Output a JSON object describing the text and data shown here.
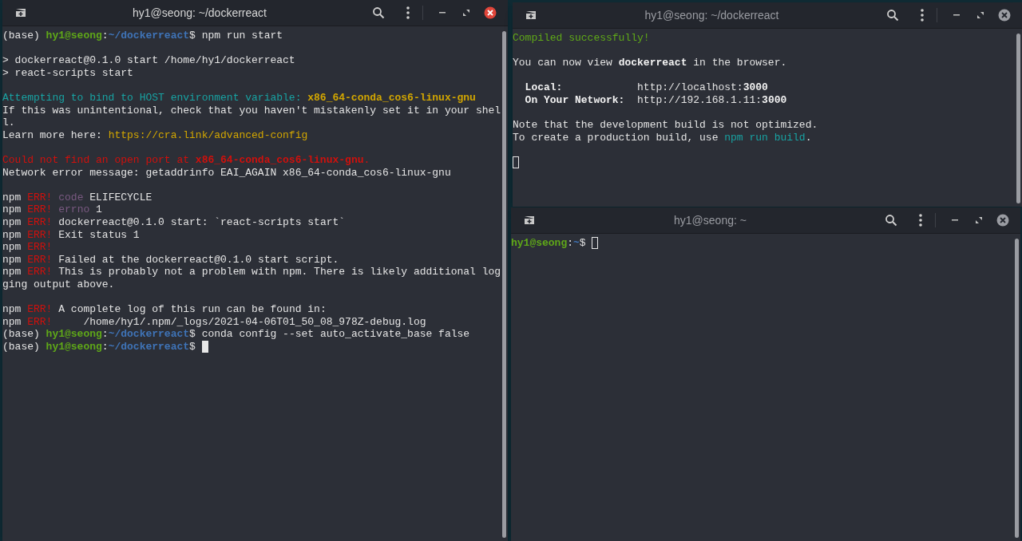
{
  "windows": [
    {
      "title": "hy1@seong: ~/dockerreact",
      "focused": true,
      "blocks": [
        {
          "lines": [
            {
              "segments": [
                {
                  "text": "(base) ",
                  "kind": "plain"
                },
                {
                  "text": "hy1@seong",
                  "kind": "user"
                },
                {
                  "text": ":",
                  "kind": "plain"
                },
                {
                  "text": "~/dockerreact",
                  "kind": "path"
                },
                {
                  "text": "$ npm run start",
                  "kind": "plain"
                }
              ]
            }
          ]
        },
        {
          "lines": [
            {
              "segments": [
                {
                  "text": "> dockerreact@0.1.0 start /home/hy1/dockerreact",
                  "kind": "plain"
                }
              ]
            },
            {
              "segments": [
                {
                  "text": "> react-scripts start",
                  "kind": "plain"
                }
              ]
            }
          ]
        },
        {
          "lines": [
            {
              "segments": [
                {
                  "text": "Attempting to bind to HOST environment variable: ",
                  "kind": "info"
                },
                {
                  "text": "x86_64-conda_cos6-linux-gnu",
                  "kind": "warn_bold"
                }
              ]
            },
            {
              "segments": [
                {
                  "text": "If this was unintentional, check that you haven't mistakenly set it in your shel",
                  "kind": "plain"
                }
              ]
            },
            {
              "segments": [
                {
                  "text": "l.",
                  "kind": "plain"
                }
              ]
            },
            {
              "segments": [
                {
                  "text": "Learn more here: ",
                  "kind": "plain"
                },
                {
                  "text": "https://cra.link/advanced-config",
                  "kind": "warn"
                }
              ]
            }
          ]
        },
        {
          "lines": [
            {
              "segments": [
                {
                  "text": "Could not find an open port at ",
                  "kind": "error"
                },
                {
                  "text": "x86_64-conda_cos6-linux-gnu",
                  "kind": "error_bold"
                },
                {
                  "text": ".",
                  "kind": "error"
                }
              ]
            },
            {
              "segments": [
                {
                  "text": "Network error message: getaddrinfo EAI_AGAIN x86_64-conda_cos6-linux-gnu",
                  "kind": "plain"
                }
              ]
            }
          ]
        },
        {
          "lines": [
            {
              "segments": [
                {
                  "text": "npm ",
                  "kind": "plain"
                },
                {
                  "text": "ERR!",
                  "kind": "error"
                },
                {
                  "text": " code",
                  "kind": "dim"
                },
                {
                  "text": " ELIFECYCLE",
                  "kind": "plain"
                }
              ]
            },
            {
              "segments": [
                {
                  "text": "npm ",
                  "kind": "plain"
                },
                {
                  "text": "ERR!",
                  "kind": "error"
                },
                {
                  "text": " errno",
                  "kind": "dim"
                },
                {
                  "text": " 1",
                  "kind": "plain"
                }
              ]
            },
            {
              "segments": [
                {
                  "text": "npm ",
                  "kind": "plain"
                },
                {
                  "text": "ERR!",
                  "kind": "error"
                },
                {
                  "text": " dockerreact@0.1.0 start: `react-scripts start`",
                  "kind": "plain"
                }
              ]
            },
            {
              "segments": [
                {
                  "text": "npm ",
                  "kind": "plain"
                },
                {
                  "text": "ERR!",
                  "kind": "error"
                },
                {
                  "text": " Exit status 1",
                  "kind": "plain"
                }
              ]
            },
            {
              "segments": [
                {
                  "text": "npm ",
                  "kind": "plain"
                },
                {
                  "text": "ERR!",
                  "kind": "error"
                }
              ]
            },
            {
              "segments": [
                {
                  "text": "npm ",
                  "kind": "plain"
                },
                {
                  "text": "ERR!",
                  "kind": "error"
                },
                {
                  "text": " Failed at the dockerreact@0.1.0 start script.",
                  "kind": "plain"
                }
              ]
            },
            {
              "segments": [
                {
                  "text": "npm ",
                  "kind": "plain"
                },
                {
                  "text": "ERR!",
                  "kind": "error"
                },
                {
                  "text": " This is probably not a problem with npm. There is likely additional log",
                  "kind": "plain"
                }
              ]
            },
            {
              "segments": [
                {
                  "text": "ging output above.",
                  "kind": "plain"
                }
              ]
            }
          ]
        },
        {
          "lines": [
            {
              "segments": [
                {
                  "text": "npm ",
                  "kind": "plain"
                },
                {
                  "text": "ERR!",
                  "kind": "error"
                },
                {
                  "text": " A complete log of this run can be found in:",
                  "kind": "plain"
                }
              ]
            },
            {
              "segments": [
                {
                  "text": "npm ",
                  "kind": "plain"
                },
                {
                  "text": "ERR!",
                  "kind": "error"
                },
                {
                  "text": "     /home/hy1/.npm/_logs/2021-04-06T01_50_08_978Z-debug.log",
                  "kind": "plain"
                }
              ]
            },
            {
              "segments": [
                {
                  "text": "(base) ",
                  "kind": "plain"
                },
                {
                  "text": "hy1@seong",
                  "kind": "user"
                },
                {
                  "text": ":",
                  "kind": "plain"
                },
                {
                  "text": "~/dockerreact",
                  "kind": "path"
                },
                {
                  "text": "$ conda config --set auto_activate_base false",
                  "kind": "plain"
                }
              ]
            },
            {
              "segments": [
                {
                  "text": "(base) ",
                  "kind": "plain"
                },
                {
                  "text": "hy1@seong",
                  "kind": "user"
                },
                {
                  "text": ":",
                  "kind": "plain"
                },
                {
                  "text": "~/dockerreact",
                  "kind": "path"
                },
                {
                  "text": "$ ",
                  "kind": "plain"
                }
              ],
              "cursor": true
            }
          ]
        }
      ]
    },
    {
      "title": "hy1@seong: ~/dockerreact",
      "focused": false,
      "blocks": [
        {
          "lines": [
            {
              "segments": [
                {
                  "text": "Compiled successfully!",
                  "kind": "success"
                }
              ]
            }
          ]
        },
        {
          "lines": [
            {
              "segments": [
                {
                  "text": "You can now view ",
                  "kind": "plain"
                },
                {
                  "text": "dockerreact",
                  "kind": "bold"
                },
                {
                  "text": " in the browser.",
                  "kind": "plain"
                }
              ]
            }
          ]
        },
        {
          "lines": [
            {
              "segments": [
                {
                  "text": "  Local:",
                  "kind": "bold"
                },
                {
                  "text": "            http://localhost:",
                  "kind": "plain"
                },
                {
                  "text": "3000",
                  "kind": "bold"
                }
              ]
            },
            {
              "segments": [
                {
                  "text": "  On Your Network:",
                  "kind": "bold"
                },
                {
                  "text": "  http://192.168.1.11:",
                  "kind": "plain"
                },
                {
                  "text": "3000",
                  "kind": "bold"
                }
              ]
            }
          ]
        },
        {
          "lines": [
            {
              "segments": [
                {
                  "text": "Note that the development build is not optimized.",
                  "kind": "plain"
                }
              ]
            },
            {
              "segments": [
                {
                  "text": "To create a production build, use ",
                  "kind": "plain"
                },
                {
                  "text": "npm run build",
                  "kind": "info"
                },
                {
                  "text": ".",
                  "kind": "plain"
                }
              ]
            }
          ]
        },
        {
          "lines": [
            {
              "cursor": true
            }
          ]
        }
      ]
    },
    {
      "title": "hy1@seong: ~",
      "focused": false,
      "blocks": [
        {
          "lines": [
            {
              "segments": [
                {
                  "text": "hy1@seong",
                  "kind": "user"
                },
                {
                  "text": ":",
                  "kind": "plain"
                },
                {
                  "text": "~",
                  "kind": "path"
                },
                {
                  "text": "$ ",
                  "kind": "plain"
                }
              ],
              "cursor": true
            }
          ]
        }
      ]
    }
  ]
}
